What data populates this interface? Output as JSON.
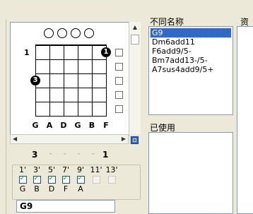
{
  "chord_diagram": {
    "start_fret": "1",
    "finger_markers": [
      "1",
      "3"
    ],
    "string_labels": [
      "G",
      "A",
      "D",
      "G",
      "B",
      "F"
    ]
  },
  "fret_position": {
    "from": "3",
    "to": "1",
    "separators": [
      "-",
      "-",
      "-",
      "-"
    ]
  },
  "intervals": [
    {
      "label": "1'",
      "checked": true,
      "note": "G"
    },
    {
      "label": "3'",
      "checked": true,
      "note": "B"
    },
    {
      "label": "5'",
      "checked": true,
      "note": "D"
    },
    {
      "label": "7'",
      "checked": true,
      "note": "F"
    },
    {
      "label": "9'",
      "checked": true,
      "note": "A"
    },
    {
      "label": "11'",
      "checked": false,
      "note": ""
    },
    {
      "label": "13'",
      "checked": false,
      "note": ""
    }
  ],
  "chord_name_value": "G9",
  "names_panel": {
    "header": "不同名称",
    "items": [
      "G9",
      "Dm6add11",
      "F6add9/5-",
      "Bm7add13-/5-",
      "A7sus4add9/5+"
    ],
    "selected_index": 0
  },
  "used_panel": {
    "header": "已使用"
  },
  "resource_panel": {
    "header": "资料"
  },
  "icons": {
    "scroll_up": "scroll-up-arrow-icon",
    "scroll_left": "scroll-left-arrow-icon",
    "scroll_right": "scroll-right-arrow-icon",
    "sync": "sync-icon"
  },
  "colors": {
    "selection": "#316ac5",
    "check": "#21a121",
    "window_bg": "#ece9d8"
  }
}
